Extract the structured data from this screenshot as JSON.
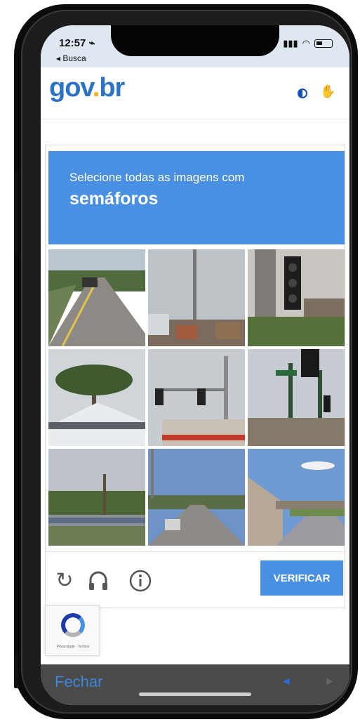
{
  "status": {
    "time": "12:57 ⌁",
    "back": "◂ Busca"
  },
  "gov": {
    "logo_part1": "gov",
    "logo_part2": "br"
  },
  "captcha": {
    "instruction": "Selecione todas as imagens com",
    "target": "semáforos",
    "verify_label": "VERIFICAR",
    "tiles": [
      "road-with-car",
      "street-pole-buildings",
      "traffic-light-closeup",
      "palm-tree-house",
      "traffic-lights-over-street",
      "traffic-light-pole",
      "highway-cars",
      "city-road",
      "highway-overpass"
    ]
  },
  "recaptcha": {
    "privacy_text": "Privacidade - Termos"
  },
  "bottom": {
    "close_label": "Fechar",
    "prev": "◄",
    "next": "►"
  },
  "colors": {
    "captcha_blue": "#4a90e2",
    "gov_blue": "#2c73c6",
    "gov_yellow": "#f6b10e"
  }
}
